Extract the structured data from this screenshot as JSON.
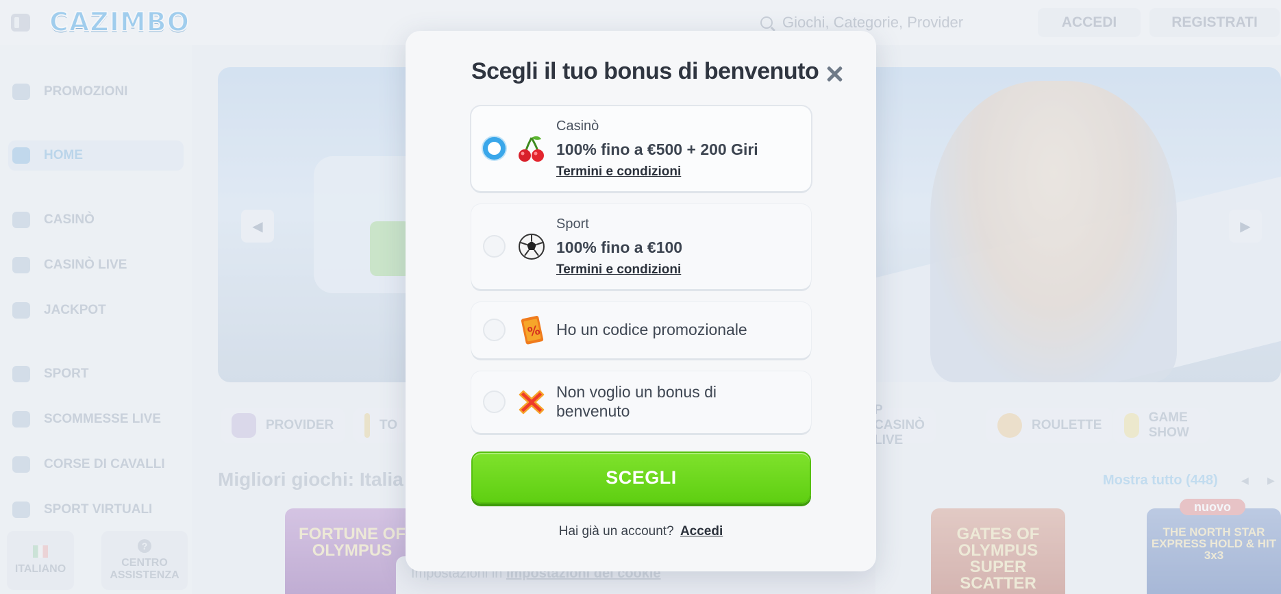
{
  "header": {
    "logo_text": "CAZIMBO",
    "search_placeholder": "Giochi, Categorie, Provider",
    "login_label": "ACCEDI",
    "register_label": "REGISTRATI"
  },
  "sidebar": {
    "items": [
      {
        "label": "PROMOZIONI",
        "icon": "gift-icon"
      },
      {
        "label": "HOME",
        "icon": "home-icon",
        "active": true
      },
      {
        "label": "CASINÒ",
        "icon": "casino-icon"
      },
      {
        "label": "CASINÒ LIVE",
        "icon": "live-casino-icon"
      },
      {
        "label": "JACKPOT",
        "icon": "jackpot-icon"
      },
      {
        "label": "SPORT",
        "icon": "sport-icon"
      },
      {
        "label": "SCOMMESSE LIVE",
        "icon": "live-bets-icon"
      },
      {
        "label": "CORSE DI CAVALLI",
        "icon": "horse-icon"
      },
      {
        "label": "SPORT VIRTUALI",
        "icon": "virtual-sport-icon"
      }
    ],
    "language_label": "ITALIANO",
    "help_label": "CENTRO ASSISTENZA"
  },
  "categories": [
    {
      "label": "PROVIDER"
    },
    {
      "label": "TO"
    },
    {
      "label": "P CASINÒ LIVE"
    },
    {
      "label": "ROULETTE"
    },
    {
      "label": "GAME SHOW"
    }
  ],
  "games_section": {
    "title": "Migliori giochi: Italia",
    "show_all": "Mostra tutto (448)",
    "games": [
      {
        "name": "FORTUNE OF OLYMPUS"
      },
      {
        "name": "GATES OF OLYMPUS SUPER SCATTER"
      },
      {
        "name": "THE NORTH STAR EXPRESS HOLD & HIT 3x3"
      }
    ],
    "new_badge": "nuovo"
  },
  "cookie": {
    "prefix": "Impostazioni in",
    "link": "Impostazioni dei cookie"
  },
  "modal": {
    "title": "Scegli il tuo bonus di benvenuto",
    "options": [
      {
        "category": "Casinò",
        "amount": "100% fino a €500 + 200 Giri",
        "terms": "Termini e condizioni",
        "icon": "cherry-icon",
        "selected": true
      },
      {
        "category": "Sport",
        "amount": "100% fino a €100",
        "terms": "Termini e condizioni",
        "icon": "soccer-ball-icon",
        "selected": false
      },
      {
        "text": "Ho un codice promozionale",
        "icon": "promo-code-icon",
        "selected": false
      },
      {
        "text": "Non voglio un bonus di benvenuto",
        "icon": "no-bonus-icon",
        "selected": false
      }
    ],
    "choose_label": "SCEGLI",
    "account_question": "Hai già un account?",
    "login_link": "Accedi"
  },
  "colors": {
    "accent_green": "#5fcf12",
    "radio_blue": "#3aa7ea"
  }
}
